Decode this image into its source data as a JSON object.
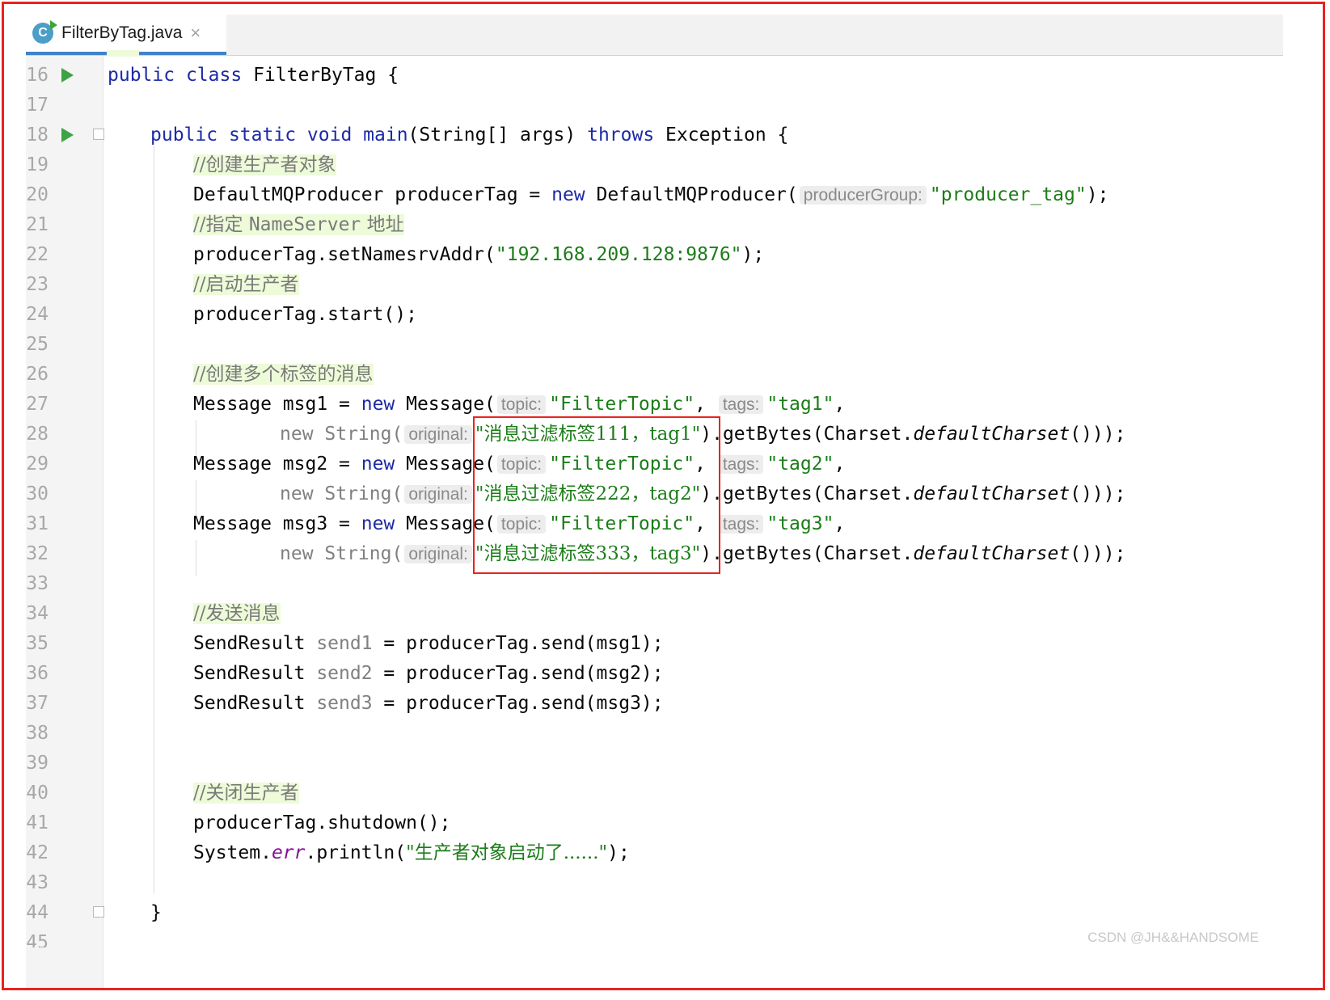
{
  "tab": {
    "filename": "FilterByTag.java",
    "icon": "java-class-icon",
    "close_glyph": "×"
  },
  "watermark": "CSDN @JH&&HANDSOME",
  "colors": {
    "keyword": "#1d2aa5",
    "string": "#1b7d18",
    "comment": "#7a7a7a",
    "comment_bg": "#edfbd9",
    "highlight_border": "#e8231f",
    "tab_underline": "#4083c9"
  },
  "lines": {
    "l16": {
      "num": "16",
      "kw1": "public",
      "kw2": "class",
      "name": "FilterByTag {"
    },
    "l17": {
      "num": "17"
    },
    "l18": {
      "num": "18",
      "kw1": "public",
      "kw2": "static",
      "kw3": "void",
      "name": "main",
      "params": "(String[] args) ",
      "kw4": "throws",
      "rest": " Exception {"
    },
    "l19": {
      "num": "19",
      "comment": "//创建生产者对象"
    },
    "l20": {
      "num": "20",
      "pre": "DefaultMQProducer producerTag = ",
      "kw": "new",
      "mid": " DefaultMQProducer(",
      "hint": "producerGroup:",
      "str": "\"producer_tag\"",
      "post": ");"
    },
    "l21": {
      "num": "21",
      "c1": "//指定 ",
      "c2": "NameServer",
      "c3": " 地址"
    },
    "l22": {
      "num": "22",
      "pre": "producerTag.setNamesrvAddr(",
      "str": "\"192.168.209.128:9876\"",
      "post": ");"
    },
    "l23": {
      "num": "23",
      "comment": "//启动生产者"
    },
    "l24": {
      "num": "24",
      "code": "producerTag.start();"
    },
    "l25": {
      "num": "25"
    },
    "l26": {
      "num": "26",
      "comment": "//创建多个标签的消息"
    },
    "l27": {
      "num": "27",
      "pre": "Message msg1 = ",
      "kw": "new",
      "mid": " Message(",
      "hint1": "topic:",
      "str1": "\"FilterTopic\"",
      "sep": ", ",
      "hint2": "tags:",
      "str2": "\"tag1\"",
      "post": ","
    },
    "l28": {
      "num": "28",
      "kw": "new",
      "cls": " String(",
      "hint": "original:",
      "str": "\"消息过滤标签111，tag1\"",
      "post1": ").getBytes(Charset.",
      "method": "defaultCharset",
      "post2": "()));"
    },
    "l29": {
      "num": "29",
      "pre": "Message msg2 = ",
      "kw": "new",
      "mid": " Message(",
      "hint1": "topic:",
      "str1": "\"FilterTopic\"",
      "sep": ", ",
      "hint2": "tags:",
      "str2": "\"tag2\"",
      "post": ","
    },
    "l30": {
      "num": "30",
      "kw": "new",
      "cls": " String(",
      "hint": "original:",
      "str": "\"消息过滤标签222，tag2\"",
      "post1": ").getBytes(Charset.",
      "method": "defaultCharset",
      "post2": "()));"
    },
    "l31": {
      "num": "31",
      "pre": "Message msg3 = ",
      "kw": "new",
      "mid": " Message(",
      "hint1": "topic:",
      "str1": "\"FilterTopic\"",
      "sep": ", ",
      "hint2": "tags:",
      "str2": "\"tag3\"",
      "post": ","
    },
    "l32": {
      "num": "32",
      "kw": "new",
      "cls": " String(",
      "hint": "original:",
      "str": "\"消息过滤标签333，tag3\"",
      "post1": ").getBytes(Charset.",
      "method": "defaultCharset",
      "post2": "()));"
    },
    "l33": {
      "num": "33"
    },
    "l34": {
      "num": "34",
      "comment": "//发送消息"
    },
    "l35": {
      "num": "35",
      "type": "SendResult ",
      "var": "send1",
      "rest": " = producerTag.send(msg1);"
    },
    "l36": {
      "num": "36",
      "type": "SendResult ",
      "var": "send2",
      "rest": " = producerTag.send(msg2);"
    },
    "l37": {
      "num": "37",
      "type": "SendResult ",
      "var": "send3",
      "rest": " = producerTag.send(msg3);"
    },
    "l38": {
      "num": "38"
    },
    "l39": {
      "num": "39"
    },
    "l40": {
      "num": "40",
      "comment": "//关闭生产者"
    },
    "l41": {
      "num": "41",
      "code": "producerTag.shutdown();"
    },
    "l42": {
      "num": "42",
      "pre": "System.",
      "field": "err",
      "mid": ".println(",
      "str": "\"生产者对象启动了......\"",
      "post": ");"
    },
    "l43": {
      "num": "43"
    },
    "l44": {
      "num": "44",
      "code": "}"
    },
    "l45": {
      "num": "45"
    }
  }
}
